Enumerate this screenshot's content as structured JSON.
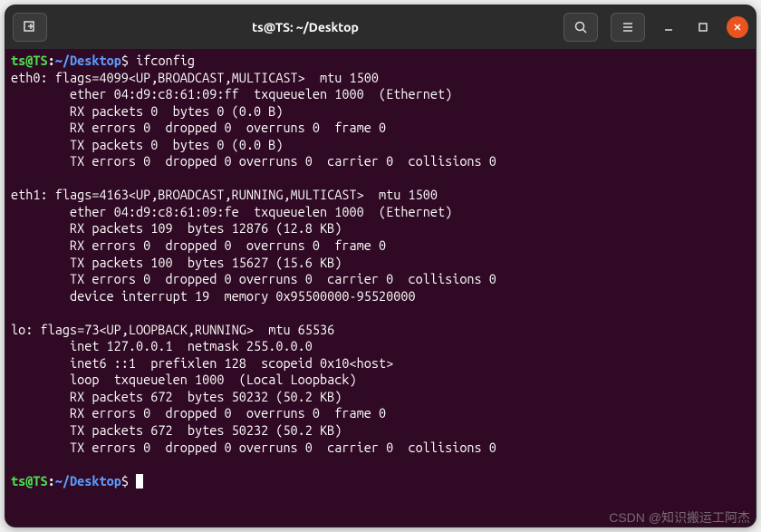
{
  "titlebar": {
    "title": "ts@TS: ~/Desktop"
  },
  "prompt": {
    "user_host": "ts@TS",
    "path": "~/Desktop",
    "symbol": "$"
  },
  "command1": "ifconfig",
  "output": {
    "eth0": {
      "header": "eth0: flags=4099<UP,BROADCAST,MULTICAST>  mtu 1500",
      "ether": "        ether 04:d9:c8:61:09:ff  txqueuelen 1000  (Ethernet)",
      "rx_pk": "        RX packets 0  bytes 0 (0.0 B)",
      "rx_err": "        RX errors 0  dropped 0  overruns 0  frame 0",
      "tx_pk": "        TX packets 0  bytes 0 (0.0 B)",
      "tx_err": "        TX errors 0  dropped 0 overruns 0  carrier 0  collisions 0"
    },
    "eth1": {
      "header": "eth1: flags=4163<UP,BROADCAST,RUNNING,MULTICAST>  mtu 1500",
      "ether": "        ether 04:d9:c8:61:09:fe  txqueuelen 1000  (Ethernet)",
      "rx_pk": "        RX packets 109  bytes 12876 (12.8 KB)",
      "rx_err": "        RX errors 0  dropped 0  overruns 0  frame 0",
      "tx_pk": "        TX packets 100  bytes 15627 (15.6 KB)",
      "tx_err": "        TX errors 0  dropped 0 overruns 0  carrier 0  collisions 0",
      "dev": "        device interrupt 19  memory 0x95500000-95520000"
    },
    "lo": {
      "header": "lo: flags=73<UP,LOOPBACK,RUNNING>  mtu 65536",
      "inet": "        inet 127.0.0.1  netmask 255.0.0.0",
      "inet6": "        inet6 ::1  prefixlen 128  scopeid 0x10<host>",
      "loop": "        loop  txqueuelen 1000  (Local Loopback)",
      "rx_pk": "        RX packets 672  bytes 50232 (50.2 KB)",
      "rx_err": "        RX errors 0  dropped 0  overruns 0  frame 0",
      "tx_pk": "        TX packets 672  bytes 50232 (50.2 KB)",
      "tx_err": "        TX errors 0  dropped 0 overruns 0  carrier 0  collisions 0"
    }
  },
  "watermark": "CSDN @知识搬运工阿杰"
}
